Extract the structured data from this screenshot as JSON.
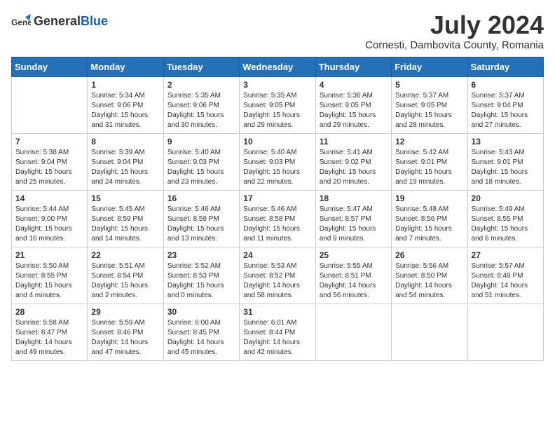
{
  "header": {
    "logo": {
      "general": "General",
      "blue": "Blue"
    },
    "title": "July 2024",
    "location": "Cornesti, Dambovita County, Romania"
  },
  "weekdays": [
    "Sunday",
    "Monday",
    "Tuesday",
    "Wednesday",
    "Thursday",
    "Friday",
    "Saturday"
  ],
  "weeks": [
    [
      {
        "day": "",
        "info": ""
      },
      {
        "day": "1",
        "info": "Sunrise: 5:34 AM\nSunset: 9:06 PM\nDaylight: 15 hours\nand 31 minutes."
      },
      {
        "day": "2",
        "info": "Sunrise: 5:35 AM\nSunset: 9:06 PM\nDaylight: 15 hours\nand 30 minutes."
      },
      {
        "day": "3",
        "info": "Sunrise: 5:35 AM\nSunset: 9:05 PM\nDaylight: 15 hours\nand 29 minutes."
      },
      {
        "day": "4",
        "info": "Sunrise: 5:36 AM\nSunset: 9:05 PM\nDaylight: 15 hours\nand 29 minutes."
      },
      {
        "day": "5",
        "info": "Sunrise: 5:37 AM\nSunset: 9:05 PM\nDaylight: 15 hours\nand 28 minutes."
      },
      {
        "day": "6",
        "info": "Sunrise: 5:37 AM\nSunset: 9:04 PM\nDaylight: 15 hours\nand 27 minutes."
      }
    ],
    [
      {
        "day": "7",
        "info": "Sunrise: 5:38 AM\nSunset: 9:04 PM\nDaylight: 15 hours\nand 25 minutes."
      },
      {
        "day": "8",
        "info": "Sunrise: 5:39 AM\nSunset: 9:04 PM\nDaylight: 15 hours\nand 24 minutes."
      },
      {
        "day": "9",
        "info": "Sunrise: 5:40 AM\nSunset: 9:03 PM\nDaylight: 15 hours\nand 23 minutes."
      },
      {
        "day": "10",
        "info": "Sunrise: 5:40 AM\nSunset: 9:03 PM\nDaylight: 15 hours\nand 22 minutes."
      },
      {
        "day": "11",
        "info": "Sunrise: 5:41 AM\nSunset: 9:02 PM\nDaylight: 15 hours\nand 20 minutes."
      },
      {
        "day": "12",
        "info": "Sunrise: 5:42 AM\nSunset: 9:01 PM\nDaylight: 15 hours\nand 19 minutes."
      },
      {
        "day": "13",
        "info": "Sunrise: 5:43 AM\nSunset: 9:01 PM\nDaylight: 15 hours\nand 18 minutes."
      }
    ],
    [
      {
        "day": "14",
        "info": "Sunrise: 5:44 AM\nSunset: 9:00 PM\nDaylight: 15 hours\nand 16 minutes."
      },
      {
        "day": "15",
        "info": "Sunrise: 5:45 AM\nSunset: 8:59 PM\nDaylight: 15 hours\nand 14 minutes."
      },
      {
        "day": "16",
        "info": "Sunrise: 5:46 AM\nSunset: 8:59 PM\nDaylight: 15 hours\nand 13 minutes."
      },
      {
        "day": "17",
        "info": "Sunrise: 5:46 AM\nSunset: 8:58 PM\nDaylight: 15 hours\nand 11 minutes."
      },
      {
        "day": "18",
        "info": "Sunrise: 5:47 AM\nSunset: 8:57 PM\nDaylight: 15 hours\nand 9 minutes."
      },
      {
        "day": "19",
        "info": "Sunrise: 5:48 AM\nSunset: 8:56 PM\nDaylight: 15 hours\nand 7 minutes."
      },
      {
        "day": "20",
        "info": "Sunrise: 5:49 AM\nSunset: 8:55 PM\nDaylight: 15 hours\nand 6 minutes."
      }
    ],
    [
      {
        "day": "21",
        "info": "Sunrise: 5:50 AM\nSunset: 8:55 PM\nDaylight: 15 hours\nand 4 minutes."
      },
      {
        "day": "22",
        "info": "Sunrise: 5:51 AM\nSunset: 8:54 PM\nDaylight: 15 hours\nand 2 minutes."
      },
      {
        "day": "23",
        "info": "Sunrise: 5:52 AM\nSunset: 8:53 PM\nDaylight: 15 hours\nand 0 minutes."
      },
      {
        "day": "24",
        "info": "Sunrise: 5:53 AM\nSunset: 8:52 PM\nDaylight: 14 hours\nand 58 minutes."
      },
      {
        "day": "25",
        "info": "Sunrise: 5:55 AM\nSunset: 8:51 PM\nDaylight: 14 hours\nand 56 minutes."
      },
      {
        "day": "26",
        "info": "Sunrise: 5:56 AM\nSunset: 8:50 PM\nDaylight: 14 hours\nand 54 minutes."
      },
      {
        "day": "27",
        "info": "Sunrise: 5:57 AM\nSunset: 8:49 PM\nDaylight: 14 hours\nand 51 minutes."
      }
    ],
    [
      {
        "day": "28",
        "info": "Sunrise: 5:58 AM\nSunset: 8:47 PM\nDaylight: 14 hours\nand 49 minutes."
      },
      {
        "day": "29",
        "info": "Sunrise: 5:59 AM\nSunset: 8:46 PM\nDaylight: 14 hours\nand 47 minutes."
      },
      {
        "day": "30",
        "info": "Sunrise: 6:00 AM\nSunset: 8:45 PM\nDaylight: 14 hours\nand 45 minutes."
      },
      {
        "day": "31",
        "info": "Sunrise: 6:01 AM\nSunset: 8:44 PM\nDaylight: 14 hours\nand 42 minutes."
      },
      {
        "day": "",
        "info": ""
      },
      {
        "day": "",
        "info": ""
      },
      {
        "day": "",
        "info": ""
      }
    ]
  ]
}
